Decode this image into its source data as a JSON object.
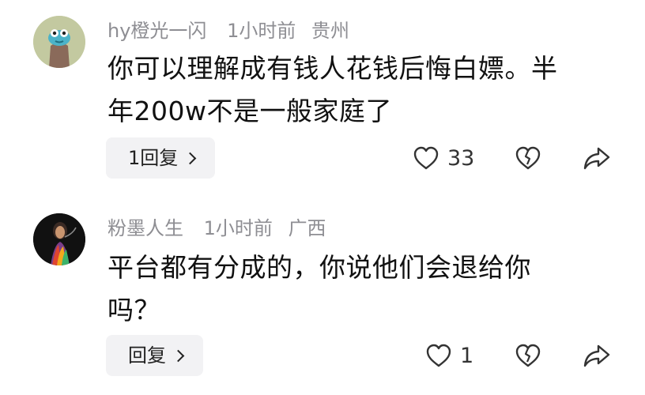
{
  "comments": [
    {
      "username": "hy橙光一闪",
      "time": "1小时前",
      "location": "贵州",
      "text_line1": "你可以理解成有钱人花钱后悔白嫖。半",
      "text_line2": "年200w不是一般家庭了",
      "reply_label": "1回复",
      "like_count": "33",
      "avatar_icon": "green-monster-avatar"
    },
    {
      "username": "粉墨人生",
      "time": "1小时前",
      "location": "广西",
      "text_line1": "平台都有分成的，你说他们会退给你",
      "text_line2": "吗？",
      "reply_label": "回复",
      "like_count": "1",
      "avatar_icon": "dark-portrait-avatar"
    }
  ],
  "icons": {
    "like": "heart-outline-icon",
    "dislike": "broken-heart-icon",
    "share": "share-arrow-icon",
    "chevron": "chevron-right-icon"
  }
}
